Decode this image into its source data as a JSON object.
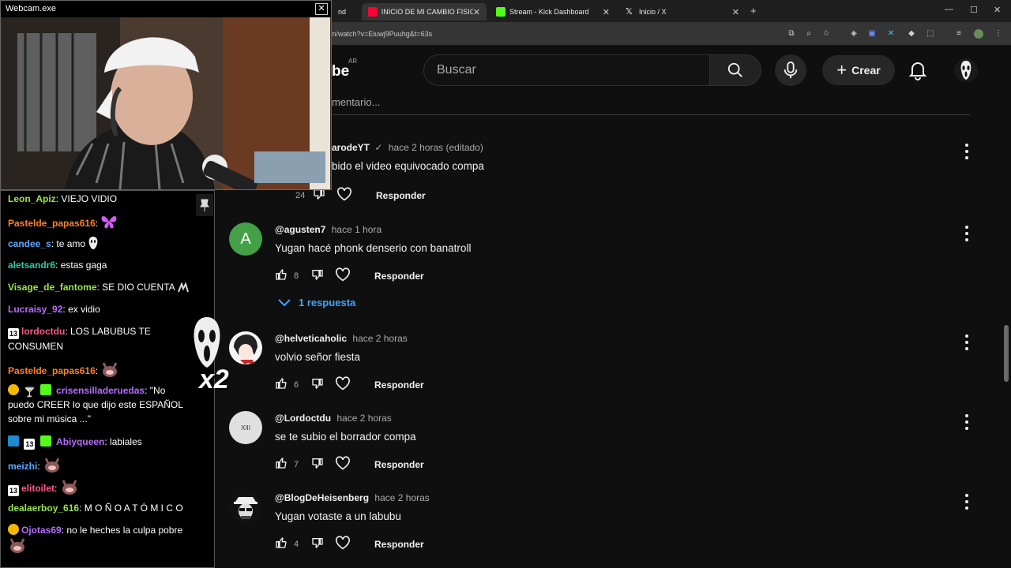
{
  "browser": {
    "tabs": [
      {
        "label": "nd"
      },
      {
        "label": "INICIO DE MI CAMBIO FISICO 💪"
      },
      {
        "label": "Stream - Kick Dashboard"
      },
      {
        "label": "Inicio / X"
      }
    ],
    "new_tab": "+",
    "url": "m/watch?v=Eiuwj9Puuhg&t=63s",
    "window_controls": {
      "minimize": "—",
      "maximize": "☐",
      "close": "✕"
    }
  },
  "youtube": {
    "logo": "be",
    "country_code": "AR",
    "search_placeholder": "Buscar",
    "create_label": "Crear",
    "add_comment_placeholder": "mentario..."
  },
  "comments": [
    {
      "author": "arodeYT",
      "verified": "✓",
      "time": "hace 2 horas (editado)",
      "text": "bido el video equivocado compa",
      "likes": "24",
      "reply_label": "Responder"
    },
    {
      "author": "@agusten7",
      "time": "hace 1 hora",
      "text": "Yugan hacé phonk denserio con banatroll",
      "likes": "8",
      "reply_label": "Responder",
      "avatar_letter": "A",
      "avatar_color": "#43a047",
      "replies": "1 respuesta"
    },
    {
      "author": "@helveticaholic",
      "time": "hace 2 horas",
      "text": "volvio señor fiesta",
      "likes": "6",
      "reply_label": "Responder"
    },
    {
      "author": "@Lordoctdu",
      "time": "hace 2 horas",
      "text": "se te subio el borrador compa",
      "likes": "7",
      "reply_label": "Responder",
      "avatar_letter": "XIII"
    },
    {
      "author": "@BlogDeHeisenberg",
      "time": "hace 2 horas",
      "text": "Yugan votaste a un labubu",
      "likes": "4",
      "reply_label": "Responder"
    }
  ],
  "webcam": {
    "title": "Webcam.exe",
    "close": "✕"
  },
  "chat": {
    "messages": [
      {
        "user": "Leon_Apiz",
        "color": "#9be34a",
        "sep": ":",
        "text": " VIEJO VIDIO"
      },
      {
        "user": "Pastelde_papas616",
        "color": "#ff7f2a",
        "sep": ":",
        "text": ""
      },
      {
        "user": "candee_s",
        "color": "#5fa8ff",
        "sep": ":",
        "text": " te amo"
      },
      {
        "user": "aletsandr6",
        "color": "#2ec7a4",
        "sep": ":",
        "text": " estas gaga"
      },
      {
        "user": "Visage_de_fantome",
        "color": "#9be34a",
        "sep": ":",
        "text": " SE DIO CUENTA"
      },
      {
        "user": "Lucraisy_92",
        "color": "#b56cff",
        "sep": ":",
        "text": " ex vidio"
      },
      {
        "user": "lordoctdu",
        "color": "#ff5a8a",
        "sep": ":",
        "text": " LOS LABUBUS TE",
        "text2": "CONSUMEN",
        "badge": "13"
      },
      {
        "user": "Pastelde_papas616",
        "color": "#ff7f2a",
        "sep": ":",
        "text": ""
      },
      {
        "user": "crisensilladeruedas",
        "color": "#b56cff",
        "sep": ":",
        "text": " \"No",
        "text2": "puedo CREER lo que dijo este ESPAÑOL",
        "text3": "sobre mi música ...\""
      },
      {
        "user": "Abiyqueen",
        "color": "#b56cff",
        "sep": ":",
        "text": " labiales",
        "badge": "13"
      },
      {
        "user": "meizhi",
        "color": "#5fa8ff",
        "sep": ":",
        "text": ""
      },
      {
        "user": "elitoilet",
        "color": "#ff5a8a",
        "sep": ":",
        "text": "",
        "badge": "13"
      },
      {
        "user": "dealaerboy_616",
        "color": "#9be34a",
        "sep": ":",
        "text": " M O Ñ O A T Ó M I C O"
      },
      {
        "user": "Ojotas69",
        "color": "#b56cff",
        "sep": ":",
        "text": " no le heches la culpa pobre"
      }
    ],
    "ghost_multiplier": "x2"
  }
}
